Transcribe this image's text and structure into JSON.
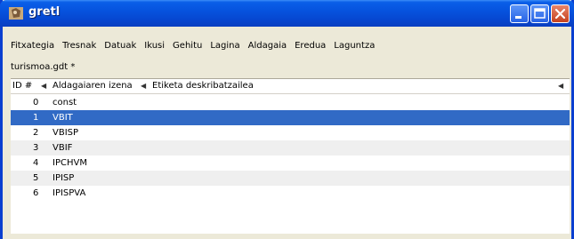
{
  "window": {
    "title": "gretl"
  },
  "menu": [
    "Fitxategia",
    "Tresnak",
    "Datuak",
    "Ikusi",
    "Gehitu",
    "Lagina",
    "Aldagaia",
    "Eredua",
    "Laguntza"
  ],
  "file_label": "turismoa.gdt *",
  "table": {
    "columns": [
      "ID #",
      "Aldagaiaren izena",
      "Etiketa deskribatzailea"
    ],
    "rows": [
      {
        "id": "0",
        "name": "const"
      },
      {
        "id": "1",
        "name": "VBIT"
      },
      {
        "id": "2",
        "name": "VBISP"
      },
      {
        "id": "3",
        "name": "VBIF"
      },
      {
        "id": "4",
        "name": "IPCHVM"
      },
      {
        "id": "5",
        "name": "IPISP"
      },
      {
        "id": "6",
        "name": "IPISPVA"
      }
    ],
    "selected_row": 1
  },
  "colors": {
    "selection": "#316ac5",
    "titlebar": "#0653de"
  }
}
